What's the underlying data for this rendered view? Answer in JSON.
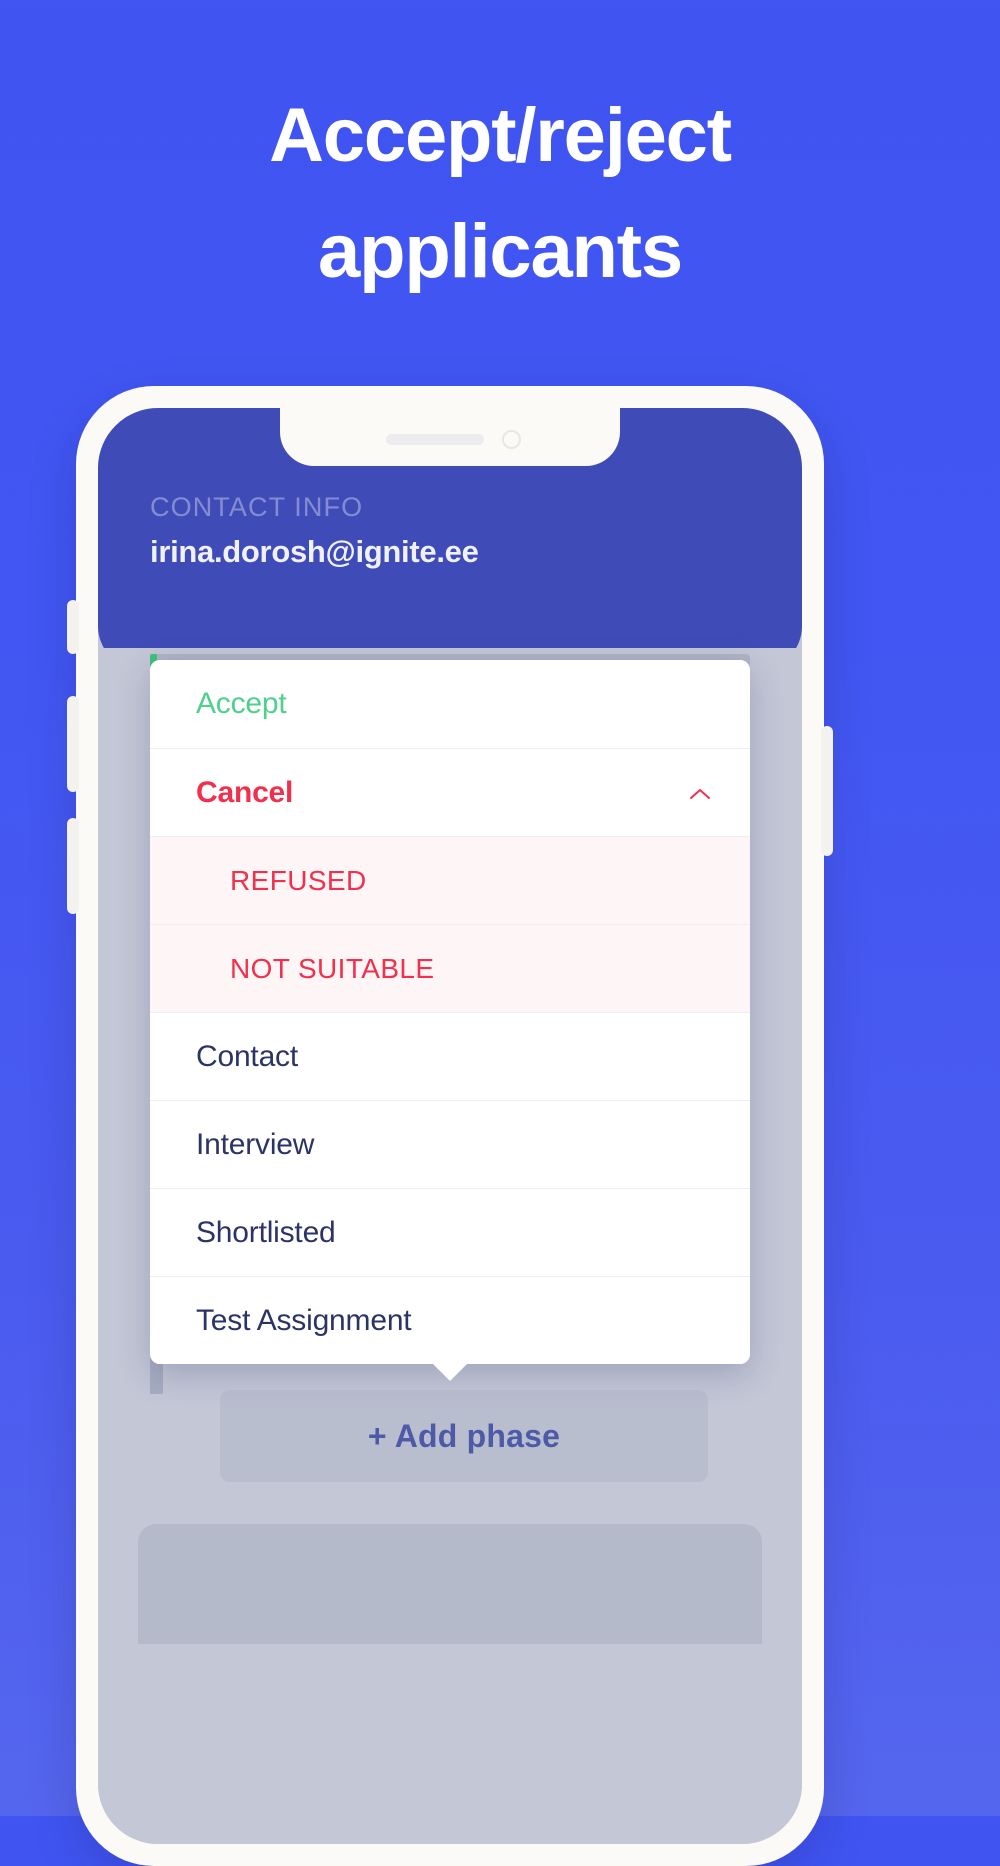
{
  "headline": {
    "line1": "Accept/reject",
    "line2": "applicants"
  },
  "phone": {
    "screen": {
      "header": {
        "contact_label": "CONTACT INFO",
        "contact_email": "irina.dorosh@ignite.ee"
      },
      "popup": {
        "items": [
          {
            "label": "Accept",
            "style": "accept",
            "icon": ""
          },
          {
            "label": "Cancel",
            "style": "cancel",
            "icon": "chevron-up-icon"
          },
          {
            "label": "REFUSED",
            "style": "sub",
            "icon": ""
          },
          {
            "label": "NOT SUITABLE",
            "style": "sub",
            "icon": ""
          },
          {
            "label": "Contact",
            "style": "plain",
            "icon": ""
          },
          {
            "label": "Interview",
            "style": "plain",
            "icon": ""
          },
          {
            "label": "Shortlisted",
            "style": "plain",
            "icon": ""
          },
          {
            "label": "Test Assignment",
            "style": "plain",
            "icon": ""
          }
        ]
      },
      "add_phase_label": "+ Add phase"
    }
  },
  "colors": {
    "background_top": "#4054F2",
    "background_bottom": "#5566EE",
    "app_header": "#3F4CB8",
    "accept_green": "#4FD08C",
    "cancel_red": "#F0304C",
    "sub_row_bg": "#FDF5F6",
    "menu_text": "#2C3466",
    "add_phase_text": "#4E5AA8",
    "phone_frame": "#FBFAF7",
    "screen_body": "#C3C7D6"
  }
}
